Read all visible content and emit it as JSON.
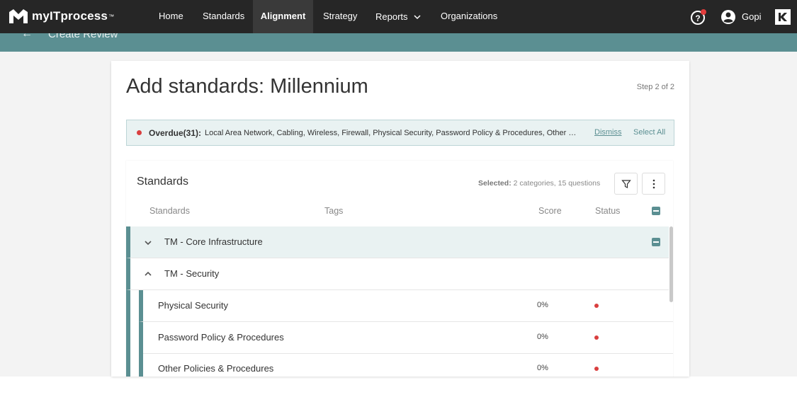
{
  "brand": {
    "name": "myITprocess",
    "tm": "™"
  },
  "nav": {
    "items": [
      "Home",
      "Standards",
      "Alignment",
      "Strategy",
      "Reports",
      "Organizations"
    ],
    "active": "Alignment",
    "user": "Gopi"
  },
  "subbar": {
    "title": "Create Review"
  },
  "page": {
    "title": "Add standards: Millennium",
    "step": "Step 2 of 2"
  },
  "banner": {
    "label": "Overdue(31):",
    "items": "Local Area Network, Cabling, Wireless, Firewall, Physical Security, Password Policy & Procedures, Other Policies & Procedures",
    "dismiss": "Dismiss",
    "select_all": "Select All"
  },
  "panel": {
    "title": "Standards",
    "selected_label": "Selected:",
    "selected_value": "2 categories, 15 questions",
    "columns": {
      "standards": "Standards",
      "tags": "Tags",
      "score": "Score",
      "status": "Status"
    },
    "categories": [
      {
        "name": "TM - Core Infrastructure",
        "expanded": false
      },
      {
        "name": "TM - Security",
        "expanded": true
      }
    ],
    "questions": [
      {
        "name": "Physical Security",
        "score": "0%"
      },
      {
        "name": "Password Policy & Procedures",
        "score": "0%"
      },
      {
        "name": "Other Policies & Procedures",
        "score": "0%"
      }
    ]
  },
  "colors": {
    "accent": "#5b8f92",
    "nav_bg": "#262626",
    "status_red": "#d93f3f"
  }
}
